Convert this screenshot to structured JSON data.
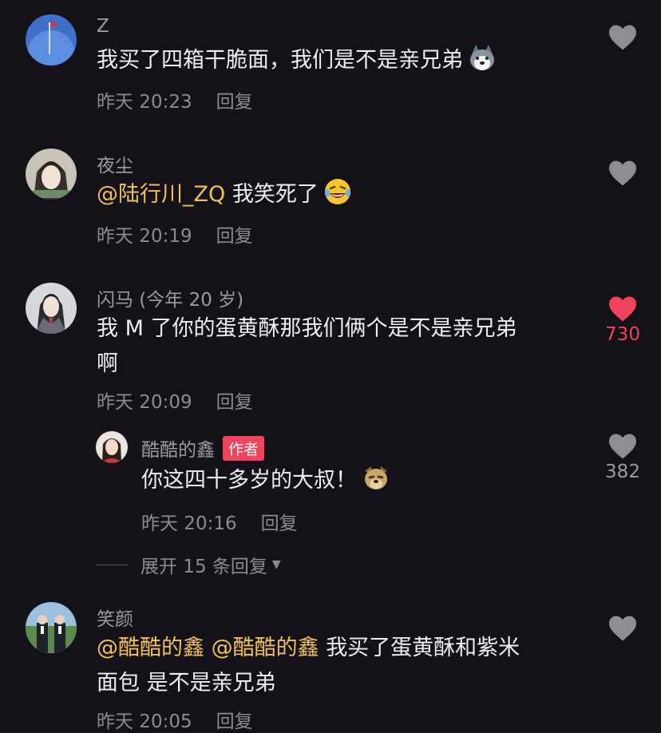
{
  "comments": [
    {
      "username": "Z",
      "text": "我买了四箱干脆面，我们是不是亲兄弟",
      "time": "昨天 20:23",
      "reply": "回复",
      "likes": ""
    },
    {
      "username": "夜尘",
      "mention": "@陆行川_ZQ",
      "text": "我笑死了",
      "time": "昨天 20:19",
      "reply": "回复",
      "likes": ""
    },
    {
      "username": "闪马 (今年 20 岁)",
      "text_line1": "我 M 了你的蛋黄酥那我们俩个是不是亲兄弟",
      "text_line2": "啊",
      "time": "昨天 20:09",
      "reply": "回复",
      "likes": "730"
    },
    {
      "username": "酷酷的鑫",
      "badge": "作者",
      "text": "你这四十多岁的大叔！",
      "time": "昨天 20:16",
      "reply": "回复",
      "likes": "382"
    },
    {
      "username": "笑颜",
      "mention1": "@酷酷的鑫",
      "mention2": "@酷酷的鑫",
      "text_line1": "我买了蛋黄酥和紫米",
      "text_line2": "面包 是不是亲兄弟",
      "time": "昨天 20:05",
      "reply": "回复",
      "likes": ""
    }
  ],
  "expand_replies": "展开 15 条回复",
  "colors": {
    "background": "#141218",
    "mention": "#f2c05a",
    "liked": "#f2435c",
    "badge": "#f2435c"
  }
}
